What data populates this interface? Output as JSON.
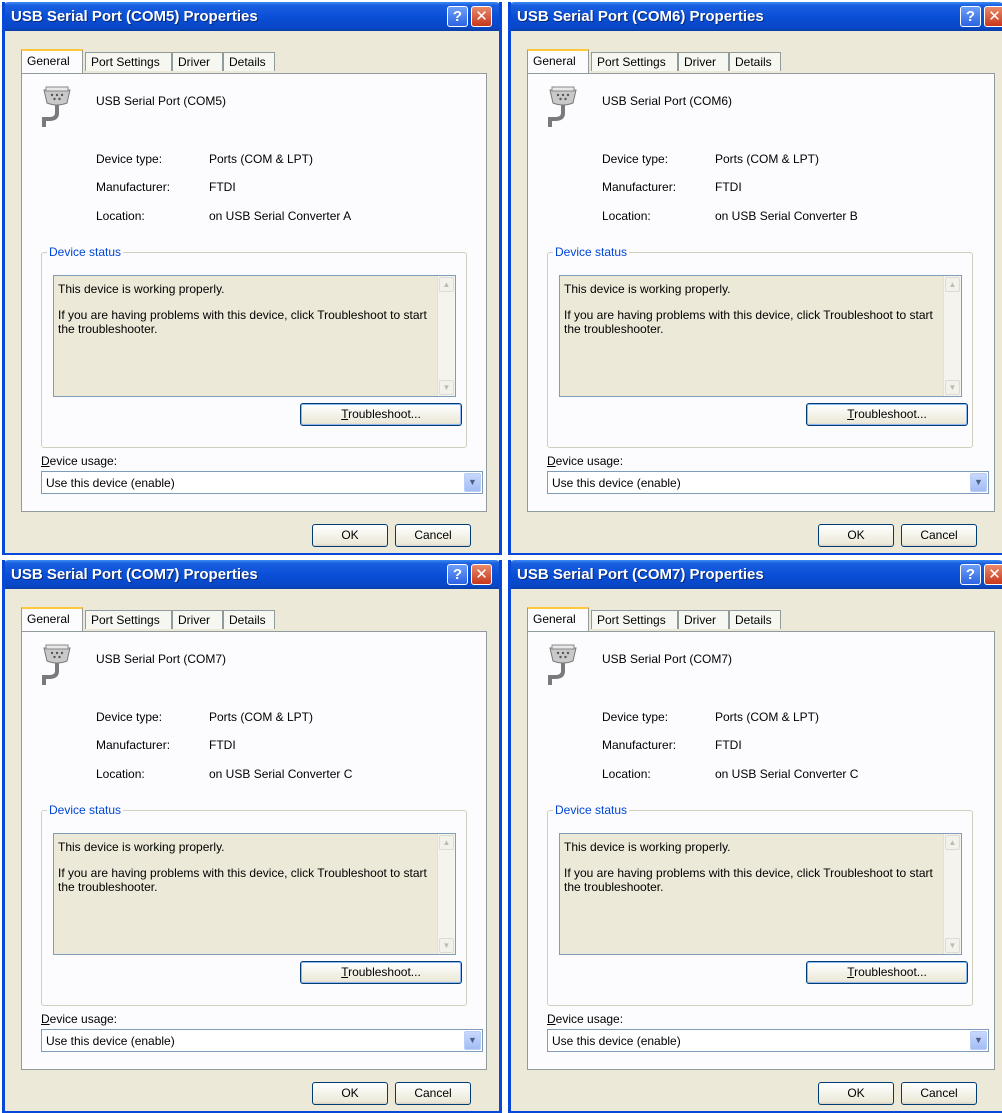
{
  "common": {
    "tabs": [
      "General",
      "Port Settings",
      "Driver",
      "Details"
    ],
    "help_glyph": "?",
    "close_glyph": "✕",
    "device_type_label": "Device type:",
    "device_type_value": "Ports (COM & LPT)",
    "manufacturer_label": "Manufacturer:",
    "manufacturer_value": "FTDI",
    "location_label": "Location:",
    "device_status_label": "Device status",
    "status_line1": "This device is working properly.",
    "status_line2": "If you are having problems with this device, click Troubleshoot to start the troubleshooter.",
    "troubleshoot_first_letter": "T",
    "troubleshoot_rest": "roubleshoot...",
    "device_usage_first_letter": "D",
    "device_usage_rest": "evice usage:",
    "device_usage_value": "Use this device (enable)",
    "ok_label": "OK",
    "cancel_label": "Cancel",
    "scroll_up_glyph": "▲",
    "scroll_down_glyph": "▼",
    "dropdown_glyph": "▼",
    "icons": [
      "help-icon",
      "close-icon",
      "serial-port-icon",
      "scroll-up-icon",
      "scroll-down-icon",
      "chevron-down-icon"
    ]
  },
  "dialogs": [
    {
      "title": "USB Serial Port (COM5) Properties",
      "device_name": "USB Serial Port (COM5)",
      "location_value": "on USB Serial Converter A"
    },
    {
      "title": "USB Serial Port (COM6) Properties",
      "device_name": "USB Serial Port (COM6)",
      "location_value": "on USB Serial Converter B"
    },
    {
      "title": "USB Serial Port (COM7) Properties",
      "device_name": "USB Serial Port (COM7)",
      "location_value": "on USB Serial Converter C"
    },
    {
      "title": "USB Serial Port (COM7) Properties",
      "device_name": "USB Serial Port (COM7)",
      "location_value": "on USB Serial Converter C"
    }
  ],
  "colors": {
    "titlebar_blue": "#0a4fd8",
    "dialog_bg": "#ece9d8",
    "group_title": "#0046d5",
    "active_tab_accent": "#ffc83c"
  }
}
